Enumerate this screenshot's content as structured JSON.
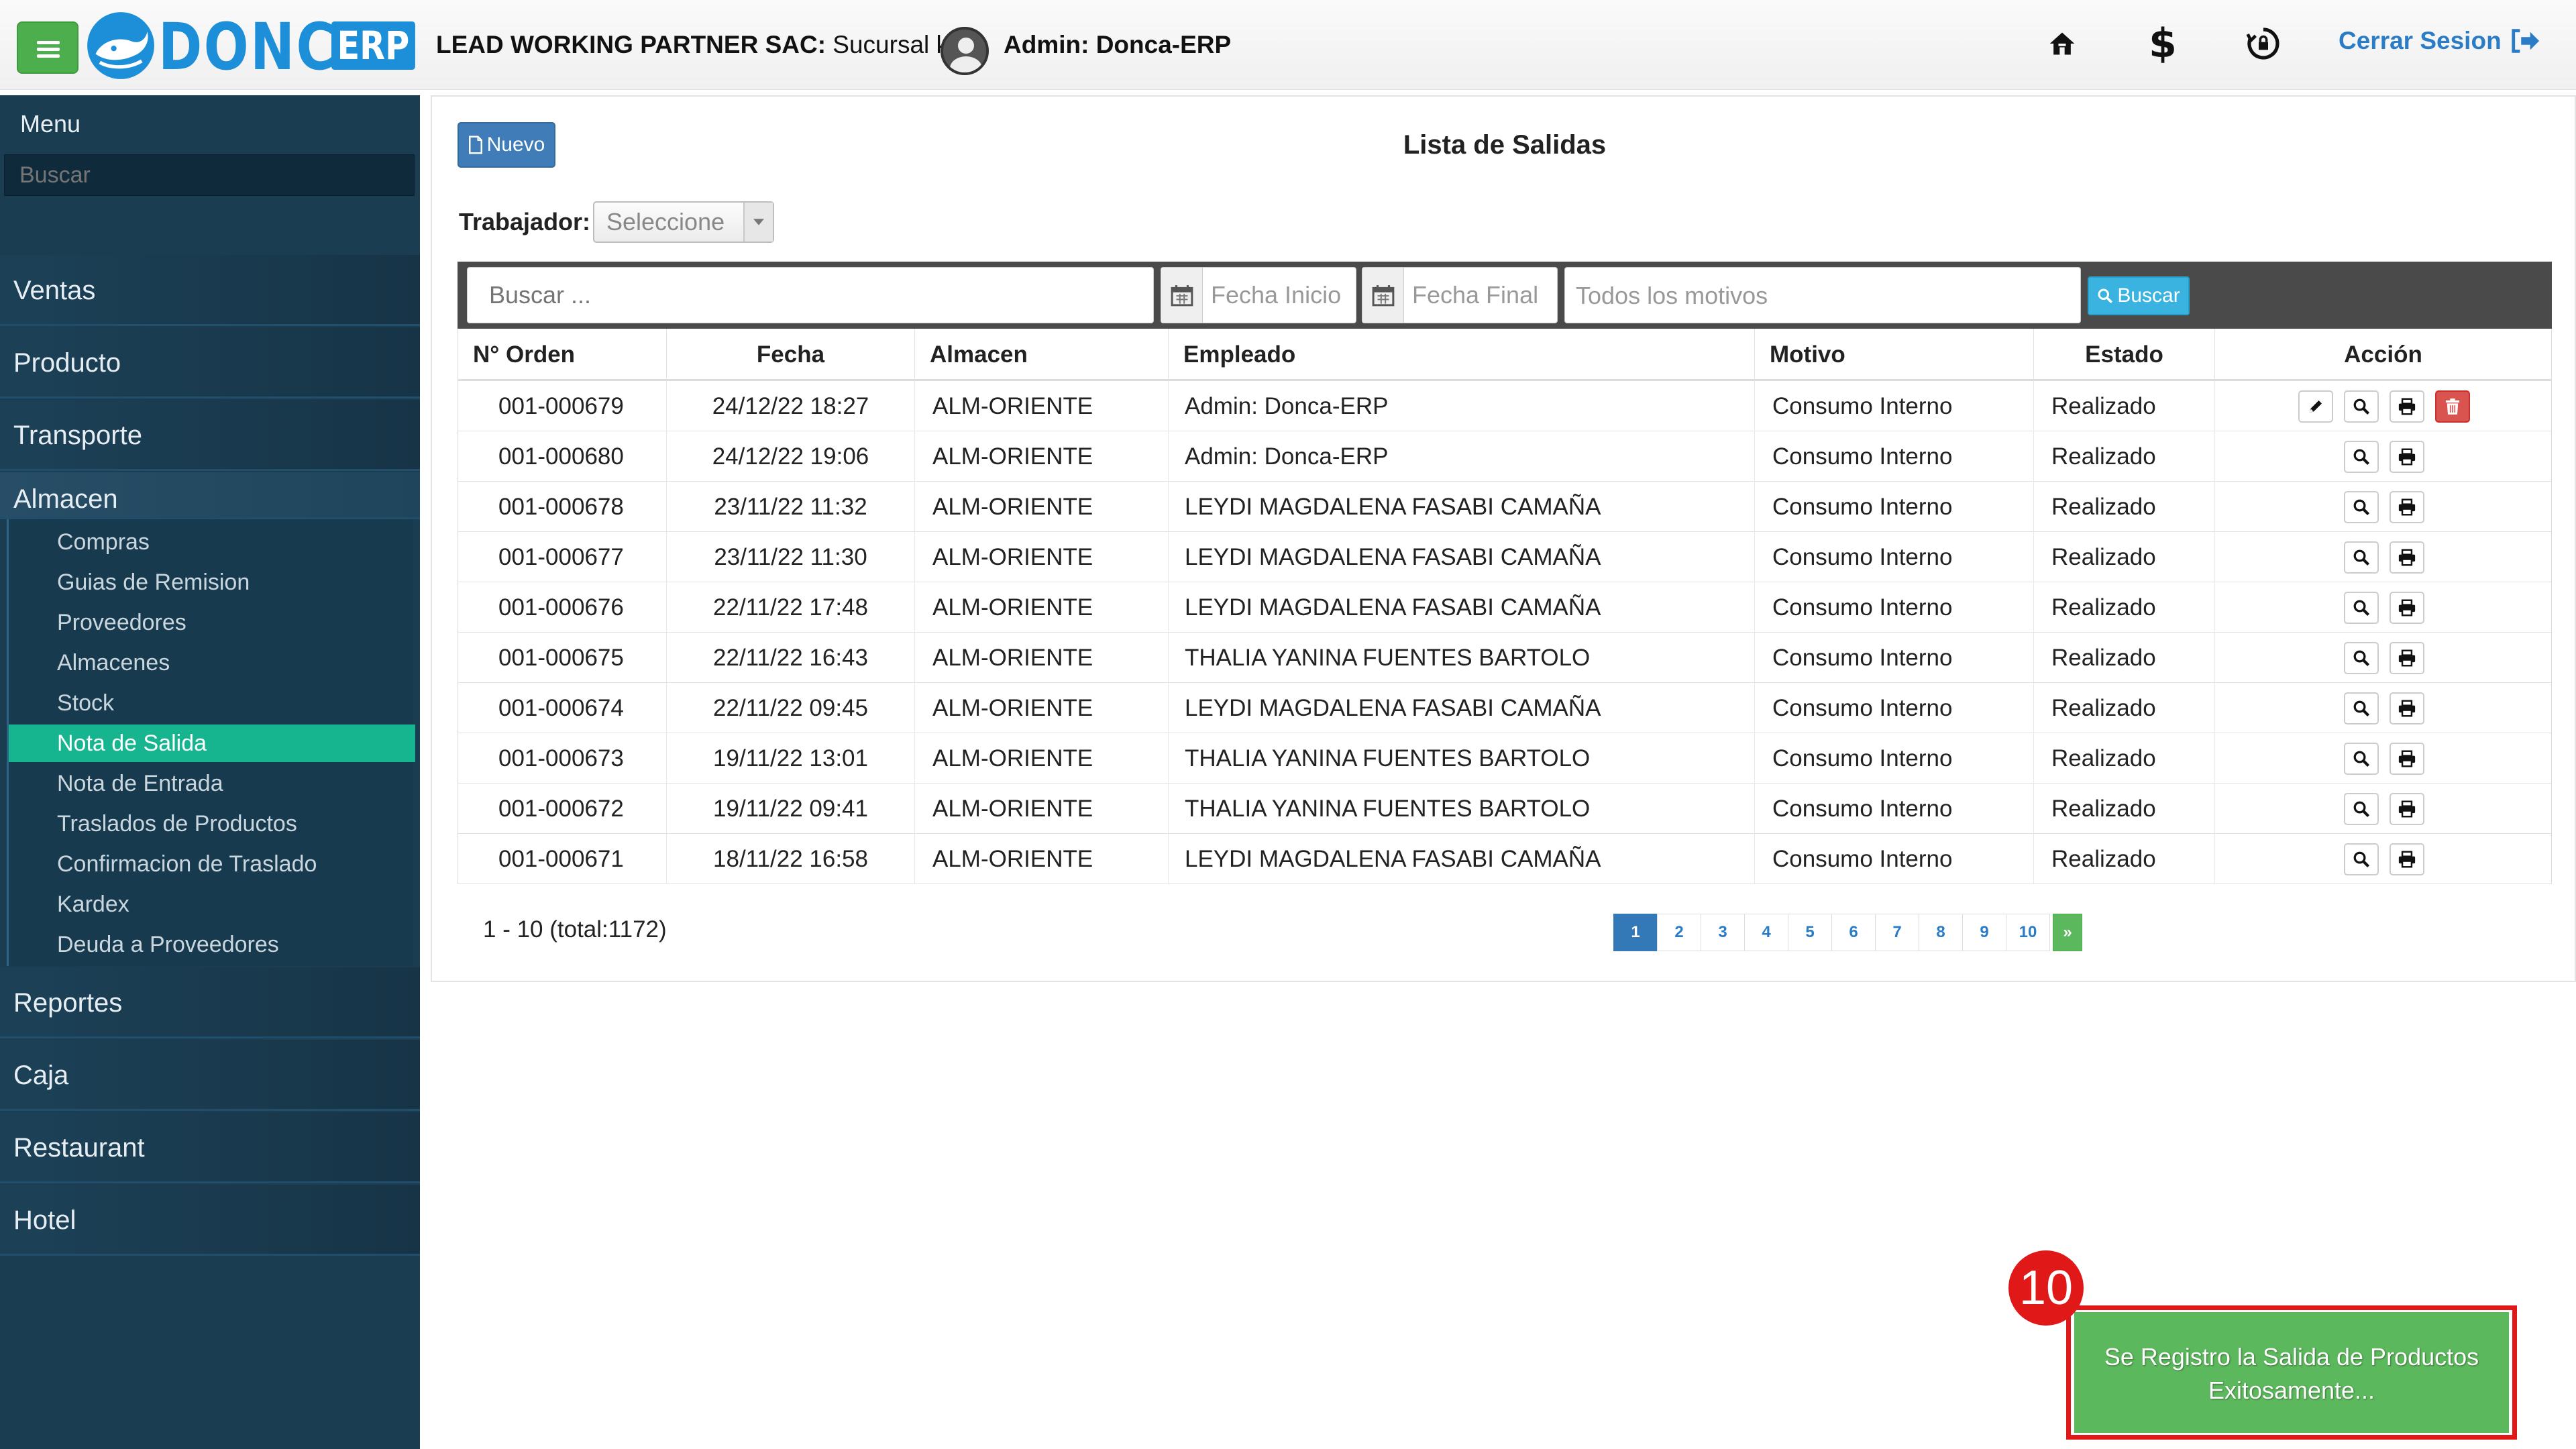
{
  "header": {
    "logo_text": "DONCA",
    "logo_badge": "ERP",
    "company_bold": "LEAD WORKING PARTNER SAC:",
    "company_rest": " Sucursal k |",
    "admin_label": "Admin: Donca-ERP",
    "logout_label": "Cerrar Sesion",
    "icons": [
      "home-icon",
      "dollar-icon",
      "sync-lock-icon",
      "sign-out-icon"
    ]
  },
  "sidebar": {
    "title": "Menu",
    "search_placeholder": "Buscar",
    "main_items": [
      "Ventas",
      "Producto",
      "Transporte",
      "Almacen",
      "Reportes",
      "Caja",
      "Restaurant",
      "Hotel"
    ],
    "almacen_sub": [
      "Compras",
      "Guias de Remision",
      "Proveedores",
      "Almacenes",
      "Stock",
      "Nota de Salida",
      "Nota de Entrada",
      "Traslados de Productos",
      "Confirmacion de Traslado",
      "Kardex",
      "Deuda a Proveedores"
    ],
    "active_sub": "Nota de Salida"
  },
  "main": {
    "new_button": "Nuevo",
    "title": "Lista de Salidas",
    "worker_label": "Trabajador:",
    "worker_select": "Seleccione",
    "filters": {
      "search_placeholder": "Buscar ...",
      "start_date_placeholder": "Fecha Inicio",
      "end_date_placeholder": "Fecha Final",
      "motive_placeholder": "Todos los motivos",
      "search_button": "Buscar"
    },
    "columns": [
      "N° Orden",
      "Fecha",
      "Almacen",
      "Empleado",
      "Motivo",
      "Estado",
      "Acción"
    ],
    "rows": [
      {
        "orden": "001-000679",
        "fecha": "24/12/22 18:27",
        "almacen": "ALM-ORIENTE",
        "empleado": "Admin: Donca-ERP",
        "motivo": "Consumo Interno",
        "estado": "Realizado",
        "actions": [
          "edit",
          "view",
          "print",
          "delete"
        ]
      },
      {
        "orden": "001-000680",
        "fecha": "24/12/22 19:06",
        "almacen": "ALM-ORIENTE",
        "empleado": "Admin: Donca-ERP",
        "motivo": "Consumo Interno",
        "estado": "Realizado",
        "actions": [
          "view",
          "print"
        ]
      },
      {
        "orden": "001-000678",
        "fecha": "23/11/22 11:32",
        "almacen": "ALM-ORIENTE",
        "empleado": "LEYDI MAGDALENA FASABI CAMAÑA",
        "motivo": "Consumo Interno",
        "estado": "Realizado",
        "actions": [
          "view",
          "print"
        ]
      },
      {
        "orden": "001-000677",
        "fecha": "23/11/22 11:30",
        "almacen": "ALM-ORIENTE",
        "empleado": "LEYDI MAGDALENA FASABI CAMAÑA",
        "motivo": "Consumo Interno",
        "estado": "Realizado",
        "actions": [
          "view",
          "print"
        ]
      },
      {
        "orden": "001-000676",
        "fecha": "22/11/22 17:48",
        "almacen": "ALM-ORIENTE",
        "empleado": "LEYDI MAGDALENA FASABI CAMAÑA",
        "motivo": "Consumo Interno",
        "estado": "Realizado",
        "actions": [
          "view",
          "print"
        ]
      },
      {
        "orden": "001-000675",
        "fecha": "22/11/22 16:43",
        "almacen": "ALM-ORIENTE",
        "empleado": "THALIA YANINA FUENTES BARTOLO",
        "motivo": "Consumo Interno",
        "estado": "Realizado",
        "actions": [
          "view",
          "print"
        ]
      },
      {
        "orden": "001-000674",
        "fecha": "22/11/22 09:45",
        "almacen": "ALM-ORIENTE",
        "empleado": "LEYDI MAGDALENA FASABI CAMAÑA",
        "motivo": "Consumo Interno",
        "estado": "Realizado",
        "actions": [
          "view",
          "print"
        ]
      },
      {
        "orden": "001-000673",
        "fecha": "19/11/22 13:01",
        "almacen": "ALM-ORIENTE",
        "empleado": "THALIA YANINA FUENTES BARTOLO",
        "motivo": "Consumo Interno",
        "estado": "Realizado",
        "actions": [
          "view",
          "print"
        ]
      },
      {
        "orden": "001-000672",
        "fecha": "19/11/22 09:41",
        "almacen": "ALM-ORIENTE",
        "empleado": "THALIA YANINA FUENTES BARTOLO",
        "motivo": "Consumo Interno",
        "estado": "Realizado",
        "actions": [
          "view",
          "print"
        ]
      },
      {
        "orden": "001-000671",
        "fecha": "18/11/22 16:58",
        "almacen": "ALM-ORIENTE",
        "empleado": "LEYDI MAGDALENA FASABI CAMAÑA",
        "motivo": "Consumo Interno",
        "estado": "Realizado",
        "actions": [
          "view",
          "print"
        ]
      }
    ],
    "pagination_info": "1 - 10 (total:1172)",
    "pages": [
      "1",
      "2",
      "3",
      "4",
      "5",
      "6",
      "7",
      "8",
      "9",
      "10"
    ],
    "active_page": "1",
    "next_label": "»"
  },
  "notification": {
    "message_line1": "Se Registro la Salida de Productos",
    "message_line2": "Exitosamente...",
    "step_number": "10"
  },
  "colors": {
    "sidebar_bg": "#1a3d52",
    "active_item": "#17b58f",
    "primary": "#3f7cb8",
    "success": "#5cb85c",
    "danger": "#d9534f",
    "highlight": "#e01818"
  }
}
